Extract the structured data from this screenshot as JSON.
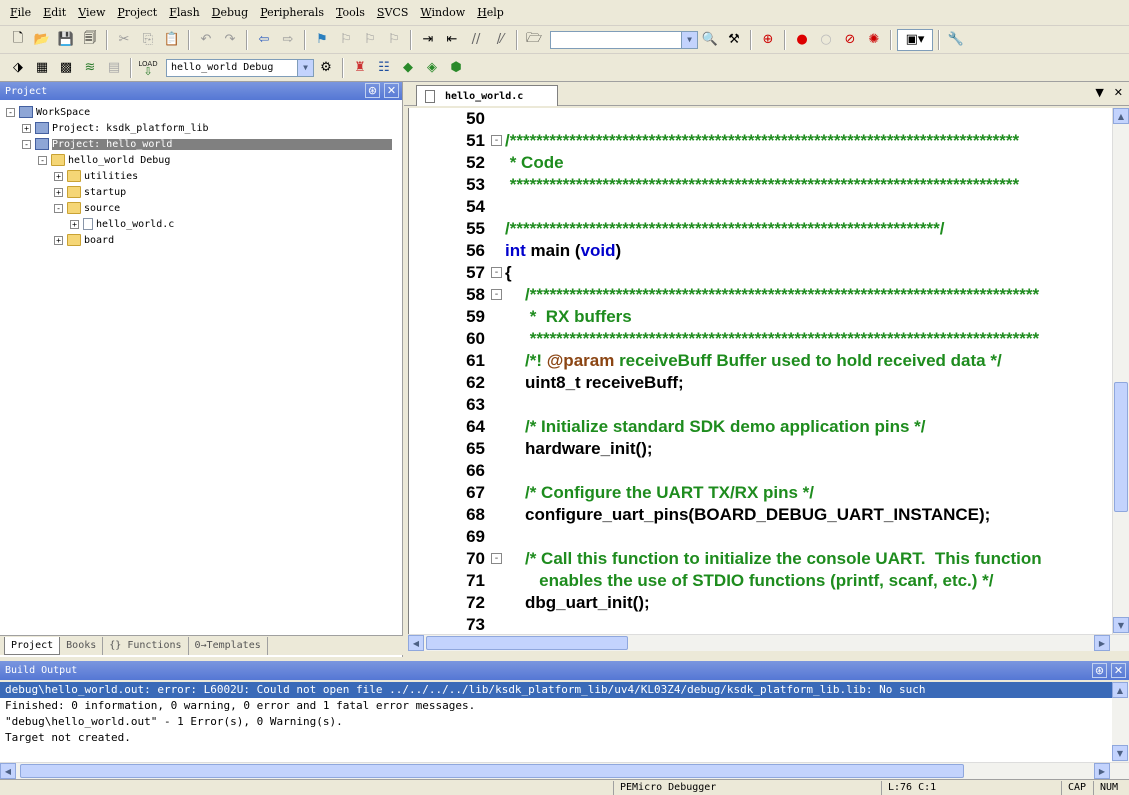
{
  "menu": {
    "items": [
      {
        "u": "F",
        "rest": "ile"
      },
      {
        "u": "E",
        "rest": "dit"
      },
      {
        "u": "V",
        "rest": "iew"
      },
      {
        "u": "P",
        "rest": "roject"
      },
      {
        "u": "F",
        "rest": "lash"
      },
      {
        "u": "D",
        "rest": "ebug"
      },
      {
        "u": "P",
        "rest": "eripherals"
      },
      {
        "u": "T",
        "rest": "ools"
      },
      {
        "u": "S",
        "rest": "VCS"
      },
      {
        "u": "W",
        "rest": "indow"
      },
      {
        "u": "H",
        "rest": "elp"
      }
    ]
  },
  "toolbar2": {
    "target": "hello_world Debug",
    "load_label": "LOAD"
  },
  "project_panel": {
    "title": "Project",
    "tree": [
      {
        "label": "WorkSpace",
        "indent": 0,
        "exp": "-",
        "icon": "proj"
      },
      {
        "label": "Project: ksdk_platform_lib",
        "indent": 1,
        "exp": "+",
        "icon": "proj"
      },
      {
        "label": "Project: hello_world",
        "indent": 1,
        "exp": "-",
        "icon": "proj",
        "selected": true
      },
      {
        "label": "hello_world Debug",
        "indent": 2,
        "exp": "-",
        "icon": "folder"
      },
      {
        "label": "utilities",
        "indent": 3,
        "exp": "+",
        "icon": "folder"
      },
      {
        "label": "startup",
        "indent": 3,
        "exp": "+",
        "icon": "folder"
      },
      {
        "label": "source",
        "indent": 3,
        "exp": "-",
        "icon": "folder"
      },
      {
        "label": "hello_world.c",
        "indent": 4,
        "exp": "+",
        "icon": "file"
      },
      {
        "label": "board",
        "indent": 3,
        "exp": "+",
        "icon": "folder"
      }
    ],
    "tabs": [
      {
        "label": "Project",
        "active": true
      },
      {
        "label": "Books",
        "active": false
      },
      {
        "label": "{} Functions",
        "active": false
      },
      {
        "label": "0→Templates",
        "active": false
      }
    ]
  },
  "editor": {
    "tab_label": "hello_world.c",
    "lines": [
      {
        "n": "50",
        "fold": "",
        "indent": 0,
        "parts": [
          {
            "t": "",
            "c": "normal"
          }
        ]
      },
      {
        "n": "51",
        "fold": "-",
        "indent": 0,
        "parts": [
          {
            "t": "/*****************************************************************************",
            "c": "comment"
          }
        ]
      },
      {
        "n": "52",
        "fold": "",
        "indent": 0,
        "parts": [
          {
            "t": " * Code",
            "c": "comment"
          }
        ]
      },
      {
        "n": "53",
        "fold": "",
        "indent": 0,
        "parts": [
          {
            "t": " *****************************************************************************",
            "c": "comment"
          }
        ]
      },
      {
        "n": "54",
        "fold": "",
        "indent": 0,
        "parts": [
          {
            "t": "",
            "c": "normal"
          }
        ]
      },
      {
        "n": "55",
        "fold": "",
        "indent": 0,
        "parts": [
          {
            "t": "/*****************************************************************/",
            "c": "comment"
          }
        ]
      },
      {
        "n": "56",
        "fold": "",
        "indent": 0,
        "parts": [
          {
            "t": "int",
            "c": "keyword"
          },
          {
            "t": " main (",
            "c": "normal"
          },
          {
            "t": "void",
            "c": "keyword"
          },
          {
            "t": ")",
            "c": "normal"
          }
        ]
      },
      {
        "n": "57",
        "fold": "-",
        "indent": 0,
        "parts": [
          {
            "t": "{",
            "c": "normal"
          }
        ]
      },
      {
        "n": "58",
        "fold": "-",
        "indent": 1,
        "parts": [
          {
            "t": "/*****************************************************************************",
            "c": "comment"
          }
        ]
      },
      {
        "n": "59",
        "fold": "",
        "indent": 1,
        "parts": [
          {
            "t": " *  RX buffers",
            "c": "comment"
          }
        ]
      },
      {
        "n": "60",
        "fold": "",
        "indent": 1,
        "parts": [
          {
            "t": " *****************************************************************************",
            "c": "comment"
          }
        ]
      },
      {
        "n": "61",
        "fold": "",
        "indent": 1,
        "parts": [
          {
            "t": "/*! ",
            "c": "comment"
          },
          {
            "t": "@param",
            "c": "doc"
          },
          {
            "t": " receiveBuff Buffer used to hold received data */",
            "c": "comment"
          }
        ]
      },
      {
        "n": "62",
        "fold": "",
        "indent": 1,
        "parts": [
          {
            "t": "uint8_t receiveBuff;",
            "c": "normal"
          }
        ]
      },
      {
        "n": "63",
        "fold": "",
        "indent": 1,
        "parts": [
          {
            "t": "",
            "c": "normal"
          }
        ]
      },
      {
        "n": "64",
        "fold": "",
        "indent": 1,
        "parts": [
          {
            "t": "/* Initialize standard SDK demo application pins */",
            "c": "comment"
          }
        ]
      },
      {
        "n": "65",
        "fold": "",
        "indent": 1,
        "parts": [
          {
            "t": "hardware_init();",
            "c": "normal"
          }
        ]
      },
      {
        "n": "66",
        "fold": "",
        "indent": 1,
        "parts": [
          {
            "t": "",
            "c": "normal"
          }
        ]
      },
      {
        "n": "67",
        "fold": "",
        "indent": 1,
        "parts": [
          {
            "t": "/* Configure the UART TX/RX pins */",
            "c": "comment"
          }
        ]
      },
      {
        "n": "68",
        "fold": "",
        "indent": 1,
        "parts": [
          {
            "t": "configure_uart_pins(BOARD_DEBUG_UART_INSTANCE);",
            "c": "normal"
          }
        ]
      },
      {
        "n": "69",
        "fold": "",
        "indent": 1,
        "parts": [
          {
            "t": "",
            "c": "normal"
          }
        ]
      },
      {
        "n": "70",
        "fold": "-",
        "indent": 1,
        "parts": [
          {
            "t": "/* Call this function to initialize the console UART.  This function",
            "c": "comment"
          }
        ]
      },
      {
        "n": "71",
        "fold": "",
        "indent": 1,
        "parts": [
          {
            "t": "   enables the use of STDIO functions (printf, scanf, etc.) */",
            "c": "comment"
          }
        ]
      },
      {
        "n": "72",
        "fold": "",
        "indent": 1,
        "parts": [
          {
            "t": "dbg_uart_init();",
            "c": "normal"
          }
        ]
      },
      {
        "n": "73",
        "fold": "",
        "indent": 1,
        "parts": [
          {
            "t": "",
            "c": "normal"
          }
        ]
      }
    ]
  },
  "build_output": {
    "title": "Build Output",
    "lines": [
      {
        "text": "debug\\hello_world.out: error: L6002U: Could not open file ../../../../lib/ksdk_platform_lib/uv4/KL03Z4/debug/ksdk_platform_lib.lib: No such",
        "error": true
      },
      {
        "text": "Finished: 0 information, 0 warning, 0 error and 1 fatal error messages.",
        "error": false
      },
      {
        "text": "\"debug\\hello_world.out\" - 1 Error(s), 0 Warning(s).",
        "error": false
      },
      {
        "text": "Target not created.",
        "error": false
      }
    ]
  },
  "status": {
    "debugger": "PEMicro Debugger",
    "position": "L:76 C:1",
    "caps": "CAP",
    "num": "NUM"
  },
  "colors": {
    "comment": "#1e8c1e",
    "keyword": "#0000cc",
    "doc": "#8b4513",
    "panel_header": "#5577d4",
    "error_highlight": "#3a6ab8"
  }
}
